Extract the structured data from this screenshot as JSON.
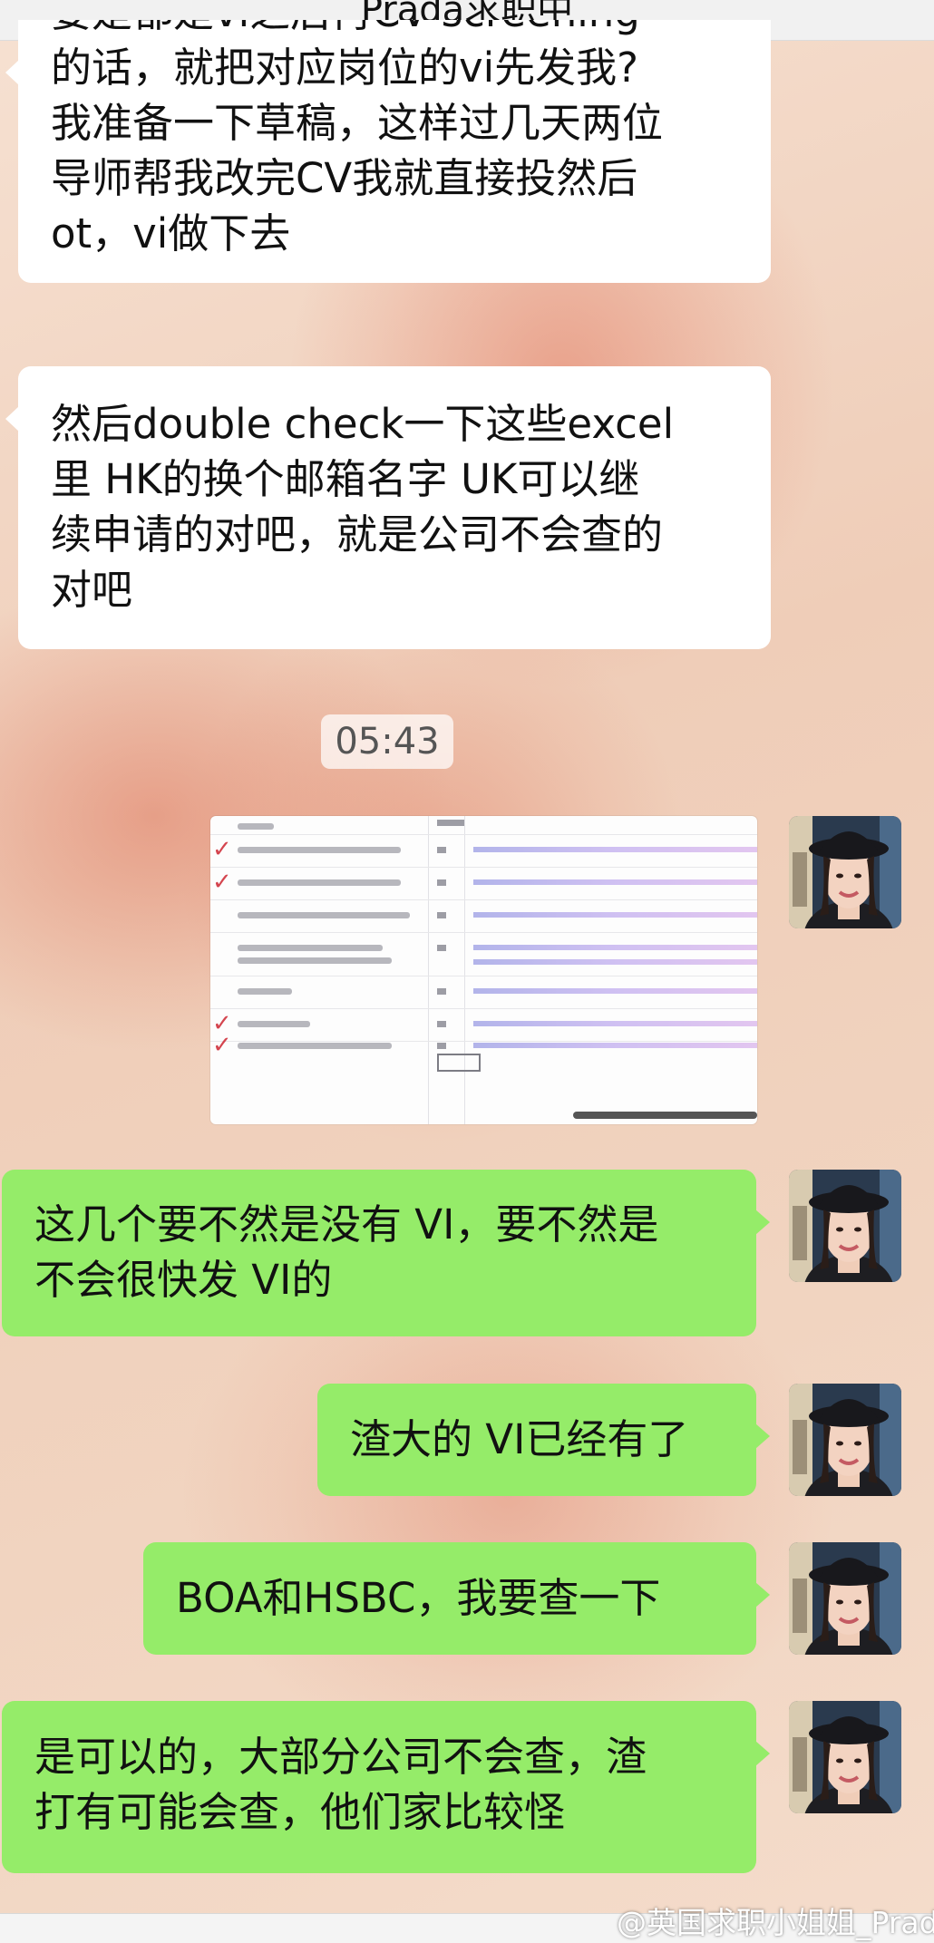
{
  "header": {
    "title": "Prada求职中"
  },
  "messages": [
    {
      "id": "m1",
      "side": "incoming",
      "partial_top_line": "要是都是vi之后再CV screening",
      "lines": [
        "的话，就把对应岗位的vi先发我?",
        "我准备一下草稿，这样过几天两位",
        "导师帮我改完CV我就直接投然后",
        "ot，vi做下去"
      ]
    },
    {
      "id": "m2",
      "side": "incoming",
      "lines": [
        "然后double check一下这些excel",
        "里 HK的换个邮箱名字 UK可以继",
        "续申请的对吧，就是公司不会查的",
        "对吧"
      ]
    },
    {
      "id": "m3",
      "side": "outgoing",
      "lines": [
        "这几个要不然是没有 VI，要不然是",
        "不会很快发 VI的"
      ]
    },
    {
      "id": "m4",
      "side": "outgoing",
      "lines": [
        "渣大的 VI已经有了"
      ]
    },
    {
      "id": "m5",
      "side": "outgoing",
      "lines": [
        "BOA和HSBC，我要查一下"
      ]
    },
    {
      "id": "m6",
      "side": "outgoing",
      "lines": [
        "是可以的，大部分公司不会查，渣",
        "打有可能会查，他们家比较怪"
      ]
    }
  ],
  "timestamp": "05:43",
  "image_message": {
    "description_icon": "spreadsheet-screenshot",
    "rows": 8,
    "checked_rows": [
      1,
      2,
      6,
      7
    ]
  },
  "watermark": "@英国求职小姐姐_Prada",
  "colors": {
    "incoming_bubble": "#ffffff",
    "outgoing_bubble": "#95ec69",
    "timestamp_bg": "#f7efe9",
    "background": "#f3d9c6"
  }
}
